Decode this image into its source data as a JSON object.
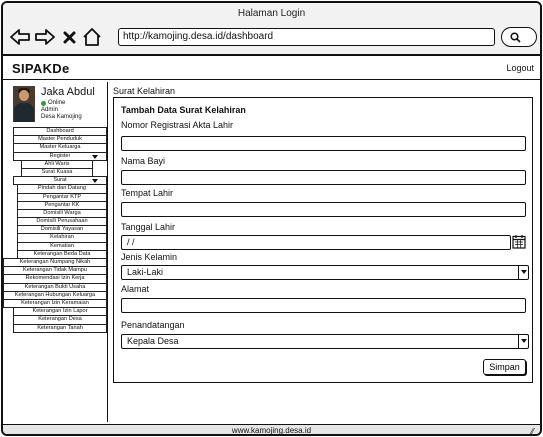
{
  "window": {
    "title": "Halaman Login",
    "url": "http://kamojing.desa.id/dashboard"
  },
  "app": {
    "brand": "SIPAKDe",
    "logout_label": "Logout",
    "footer": "www.kamojing.desa.id"
  },
  "profile": {
    "name": "Jaka Abdul",
    "status": "Online",
    "role": "Admin",
    "village": "Desa Kamojing"
  },
  "sidebar": {
    "items": [
      {
        "label": "Dashboard"
      },
      {
        "label": "Master Penduduk"
      },
      {
        "label": "Master Keluarga"
      },
      {
        "label": "Register"
      },
      {
        "label": "Ahli Waris"
      },
      {
        "label": "Surat Kuasa"
      },
      {
        "label": "Surat"
      },
      {
        "label": "Pindah dan Datang"
      },
      {
        "label": "Pengantar KTP"
      },
      {
        "label": "Pengantar KK"
      },
      {
        "label": "Domisili Warga"
      },
      {
        "label": "Domisili Perusahaan"
      },
      {
        "label": "Domisili Yayasan"
      },
      {
        "label": "Kelahiran"
      },
      {
        "label": "Kematian"
      },
      {
        "label": "Keterangan Beda Data"
      },
      {
        "label": "Keterangan Numpang Nikah"
      },
      {
        "label": "Keterangan Tidak Mampu"
      },
      {
        "label": "Rekomendasi Izin Kerja"
      },
      {
        "label": "Keterangan Bukti Usaha"
      },
      {
        "label": "Keterangan Hubungan Keluarga"
      },
      {
        "label": "Keterangan Izin Keramaian"
      },
      {
        "label": "Keterangan Izin Lapor"
      },
      {
        "label": "Keterangan Desa"
      },
      {
        "label": "Keterangan Tanah"
      }
    ]
  },
  "main": {
    "breadcrumb": "Surat Kelahiran",
    "form_title": "Tambah Data Surat Kelahiran",
    "fields": {
      "akta": {
        "label": "Nomor Registrasi Akta Lahir",
        "value": ""
      },
      "nama_bayi": {
        "label": "Nama Bayi",
        "value": ""
      },
      "tempat_lahir": {
        "label": "Tempat Lahir",
        "value": ""
      },
      "tanggal_lahir": {
        "label": "Tanggal Lahir",
        "value": "/  /"
      },
      "jenis_kelamin": {
        "label": "Jenis Kelamin",
        "value": "Laki-Laki"
      },
      "alamat": {
        "label": "Alamat",
        "value": ""
      },
      "penandatangan": {
        "label": "Penandatangan",
        "value": "Kepala Desa"
      }
    },
    "save_label": "Simpan"
  },
  "icons": {
    "back": "arrow-left-icon",
    "forward": "arrow-right-icon",
    "close": "close-icon",
    "home": "home-icon",
    "search": "search-icon",
    "calendar": "calendar-icon",
    "dropdown": "chevron-down-icon",
    "resize": "resize-grip-icon"
  }
}
